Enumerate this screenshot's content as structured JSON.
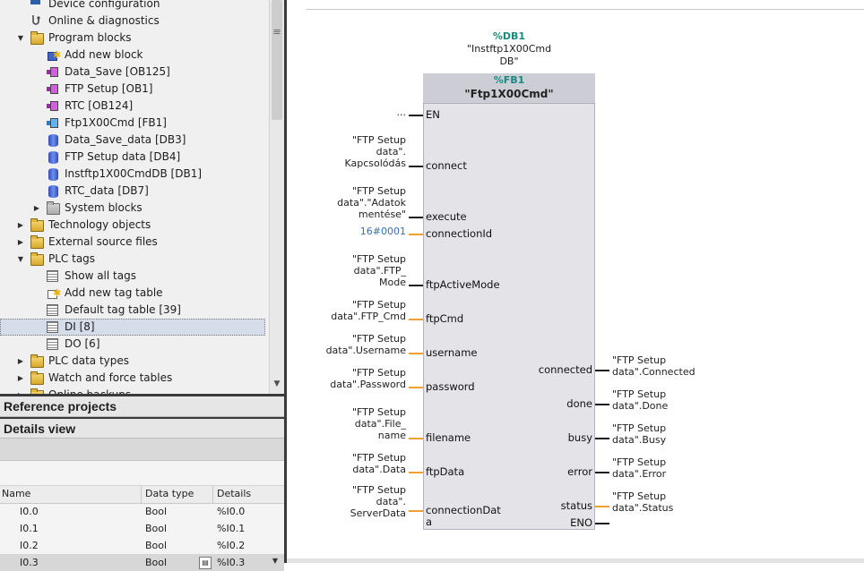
{
  "tree": {
    "items": [
      {
        "label": "Device configuration",
        "icon": "device-config-icon",
        "indent": 1,
        "arrow": ""
      },
      {
        "label": "Online & diagnostics",
        "icon": "online-diagnostics-icon",
        "indent": 1,
        "arrow": ""
      },
      {
        "label": "Program blocks",
        "icon": "folder-icon",
        "indent": 1,
        "arrow": "down"
      },
      {
        "label": "Add new block",
        "icon": "add-block-icon",
        "indent": 2,
        "arrow": ""
      },
      {
        "label": "Data_Save [OB125]",
        "icon": "ob-block-icon",
        "indent": 2,
        "arrow": ""
      },
      {
        "label": "FTP Setup [OB1]",
        "icon": "ob-block-icon",
        "indent": 2,
        "arrow": ""
      },
      {
        "label": "RTC [OB124]",
        "icon": "ob-block-icon",
        "indent": 2,
        "arrow": ""
      },
      {
        "label": "Ftp1X00Cmd [FB1]",
        "icon": "fb-block-icon",
        "indent": 2,
        "arrow": ""
      },
      {
        "label": "Data_Save_data [DB3]",
        "icon": "db-icon",
        "indent": 2,
        "arrow": ""
      },
      {
        "label": "FTP Setup data [DB4]",
        "icon": "db-icon",
        "indent": 2,
        "arrow": ""
      },
      {
        "label": "Instftp1X00CmdDB [DB1]",
        "icon": "db-icon",
        "indent": 2,
        "arrow": ""
      },
      {
        "label": "RTC_data [DB7]",
        "icon": "db-icon",
        "indent": 2,
        "arrow": ""
      },
      {
        "label": "System blocks",
        "icon": "system-folder-icon",
        "indent": 2,
        "arrow": "right"
      },
      {
        "label": "Technology objects",
        "icon": "folder-icon",
        "indent": 1,
        "arrow": "right"
      },
      {
        "label": "External source files",
        "icon": "folder-icon",
        "indent": 1,
        "arrow": "right"
      },
      {
        "label": "PLC tags",
        "icon": "folder-icon",
        "indent": 1,
        "arrow": "down"
      },
      {
        "label": "Show all tags",
        "icon": "tag-list-icon",
        "indent": 2,
        "arrow": ""
      },
      {
        "label": "Add new tag table",
        "icon": "add-tag-table-icon",
        "indent": 2,
        "arrow": ""
      },
      {
        "label": "Default tag table [39]",
        "icon": "tag-table-icon",
        "indent": 2,
        "arrow": ""
      },
      {
        "label": "DI [8]",
        "icon": "tag-table-icon",
        "indent": 2,
        "arrow": "",
        "selected": true
      },
      {
        "label": "DO [6]",
        "icon": "tag-table-icon",
        "indent": 2,
        "arrow": ""
      },
      {
        "label": "PLC data types",
        "icon": "folder-icon",
        "indent": 1,
        "arrow": "right"
      },
      {
        "label": "Watch and force tables",
        "icon": "folder-icon",
        "indent": 1,
        "arrow": "right"
      },
      {
        "label": "Online backups",
        "icon": "folder-icon",
        "indent": 1,
        "arrow": "right"
      }
    ]
  },
  "reference_projects": {
    "title": "Reference projects"
  },
  "details_view": {
    "title": "Details view",
    "columns": [
      "Name",
      "Data type",
      "Details"
    ],
    "rows": [
      {
        "name": "I0.0",
        "type": "Bool",
        "details": "%I0.0"
      },
      {
        "name": "I0.1",
        "type": "Bool",
        "details": "%I0.1"
      },
      {
        "name": "I0.2",
        "type": "Bool",
        "details": "%I0.2"
      },
      {
        "name": "I0.3",
        "type": "Bool",
        "details": "%I0.3"
      }
    ]
  },
  "editor": {
    "instance_db": {
      "address": "%DB1",
      "name_line1": "\"Instftp1X00Cmd",
      "name_line2": "DB\""
    },
    "fb": {
      "address": "%FB1",
      "name": "\"Ftp1X00Cmd\""
    },
    "inputs": [
      {
        "pin": "EN",
        "arg": [
          "..."
        ],
        "wire": "black"
      },
      {
        "pin": "connect",
        "arg": [
          "\"FTP Setup",
          "data\".",
          "Kapcsolódás"
        ],
        "wire": "black"
      },
      {
        "pin": "execute",
        "arg": [
          "\"FTP Setup",
          "data\".\"Adatok",
          "mentése\""
        ],
        "wire": "black"
      },
      {
        "pin": "connectionId",
        "arg": [
          "16#0001"
        ],
        "wire": "orange",
        "blue": true
      },
      {
        "pin": "ftpActiveMode",
        "arg": [
          "\"FTP Setup",
          "data\".FTP_",
          "Mode"
        ],
        "wire": "black"
      },
      {
        "pin": "ftpCmd",
        "arg": [
          "\"FTP Setup",
          "data\".FTP_Cmd"
        ],
        "wire": "orange"
      },
      {
        "pin": "username",
        "arg": [
          "\"FTP Setup",
          "data\".Username"
        ],
        "wire": "orange"
      },
      {
        "pin": "password",
        "arg": [
          "\"FTP Setup",
          "data\".Password"
        ],
        "wire": "orange"
      },
      {
        "pin": "filename",
        "arg": [
          "\"FTP Setup",
          "data\".File_",
          "name"
        ],
        "wire": "orange"
      },
      {
        "pin": "ftpData",
        "arg": [
          "\"FTP Setup",
          "data\".Data"
        ],
        "wire": "orange"
      },
      {
        "pin": "connectionDat",
        "pin2": "a",
        "arg": [
          "\"FTP Setup",
          "data\".",
          "ServerData"
        ],
        "wire": "orange"
      }
    ],
    "outputs": [
      {
        "pin": "connected",
        "arg": [
          "\"FTP Setup",
          "data\".Connected"
        ],
        "wire": "black"
      },
      {
        "pin": "done",
        "arg": [
          "\"FTP Setup",
          "data\".Done"
        ],
        "wire": "black"
      },
      {
        "pin": "busy",
        "arg": [
          "\"FTP Setup",
          "data\".Busy"
        ],
        "wire": "black"
      },
      {
        "pin": "error",
        "arg": [
          "\"FTP Setup",
          "data\".Error"
        ],
        "wire": "black"
      },
      {
        "pin": "status",
        "arg": [
          "\"FTP Setup",
          "data\".Status"
        ],
        "wire": "orange"
      },
      {
        "pin": "ENO",
        "arg": [],
        "wire": "black"
      }
    ]
  }
}
